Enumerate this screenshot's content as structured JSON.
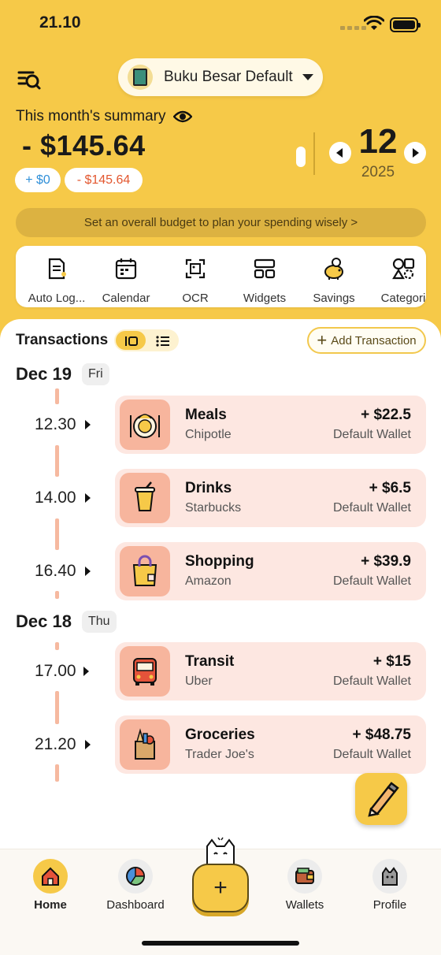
{
  "status_bar": {
    "time": "21.10"
  },
  "header": {
    "ledger_name": "Buku Besar Default",
    "summary_title": "This month's summary",
    "total": "- $145.64",
    "income_chip": "+ $0",
    "expense_chip": "- $145.64",
    "month": "12",
    "year": "2025",
    "budget_prompt": "Set an overall budget to plan your spending wisely >"
  },
  "tools": [
    {
      "label": "Auto Log...",
      "icon": "auto-log-icon"
    },
    {
      "label": "Calendar",
      "icon": "calendar-icon"
    },
    {
      "label": "OCR",
      "icon": "ocr-scan-icon"
    },
    {
      "label": "Widgets",
      "icon": "widgets-icon"
    },
    {
      "label": "Savings",
      "icon": "piggy-bank-icon"
    },
    {
      "label": "Categori",
      "icon": "categories-icon"
    }
  ],
  "transactions": {
    "title": "Transactions",
    "add_label": "Add Transaction",
    "groups": [
      {
        "date": "Dec 19",
        "dow": "Fri",
        "items": [
          {
            "time": "12.30",
            "category": "Meals",
            "note": "Chipotle",
            "amount": "+ $22.5",
            "wallet": "Default Wallet",
            "icon": "meals-icon"
          },
          {
            "time": "14.00",
            "category": "Drinks",
            "note": "Starbucks",
            "amount": "+ $6.5",
            "wallet": "Default Wallet",
            "icon": "drinks-icon"
          },
          {
            "time": "16.40",
            "category": "Shopping",
            "note": "Amazon",
            "amount": "+ $39.9",
            "wallet": "Default Wallet",
            "icon": "shopping-bag-icon"
          }
        ]
      },
      {
        "date": "Dec 18",
        "dow": "Thu",
        "items": [
          {
            "time": "17.00",
            "category": "Transit",
            "note": "Uber",
            "amount": "+ $15",
            "wallet": "Default Wallet",
            "icon": "bus-icon"
          },
          {
            "time": "21.20",
            "category": "Groceries",
            "note": "Trader Joe's",
            "amount": "+ $48.75",
            "wallet": "Default Wallet",
            "icon": "groceries-icon"
          }
        ]
      }
    ]
  },
  "nav": {
    "home": "Home",
    "dashboard": "Dashboard",
    "add": "+",
    "wallets": "Wallets",
    "profile": "Profile"
  },
  "colors": {
    "accent": "#f6c948",
    "card": "#fde7e1",
    "icon_bg": "#f7b59d",
    "income": "#2f8fd8",
    "expense": "#e3572f"
  }
}
